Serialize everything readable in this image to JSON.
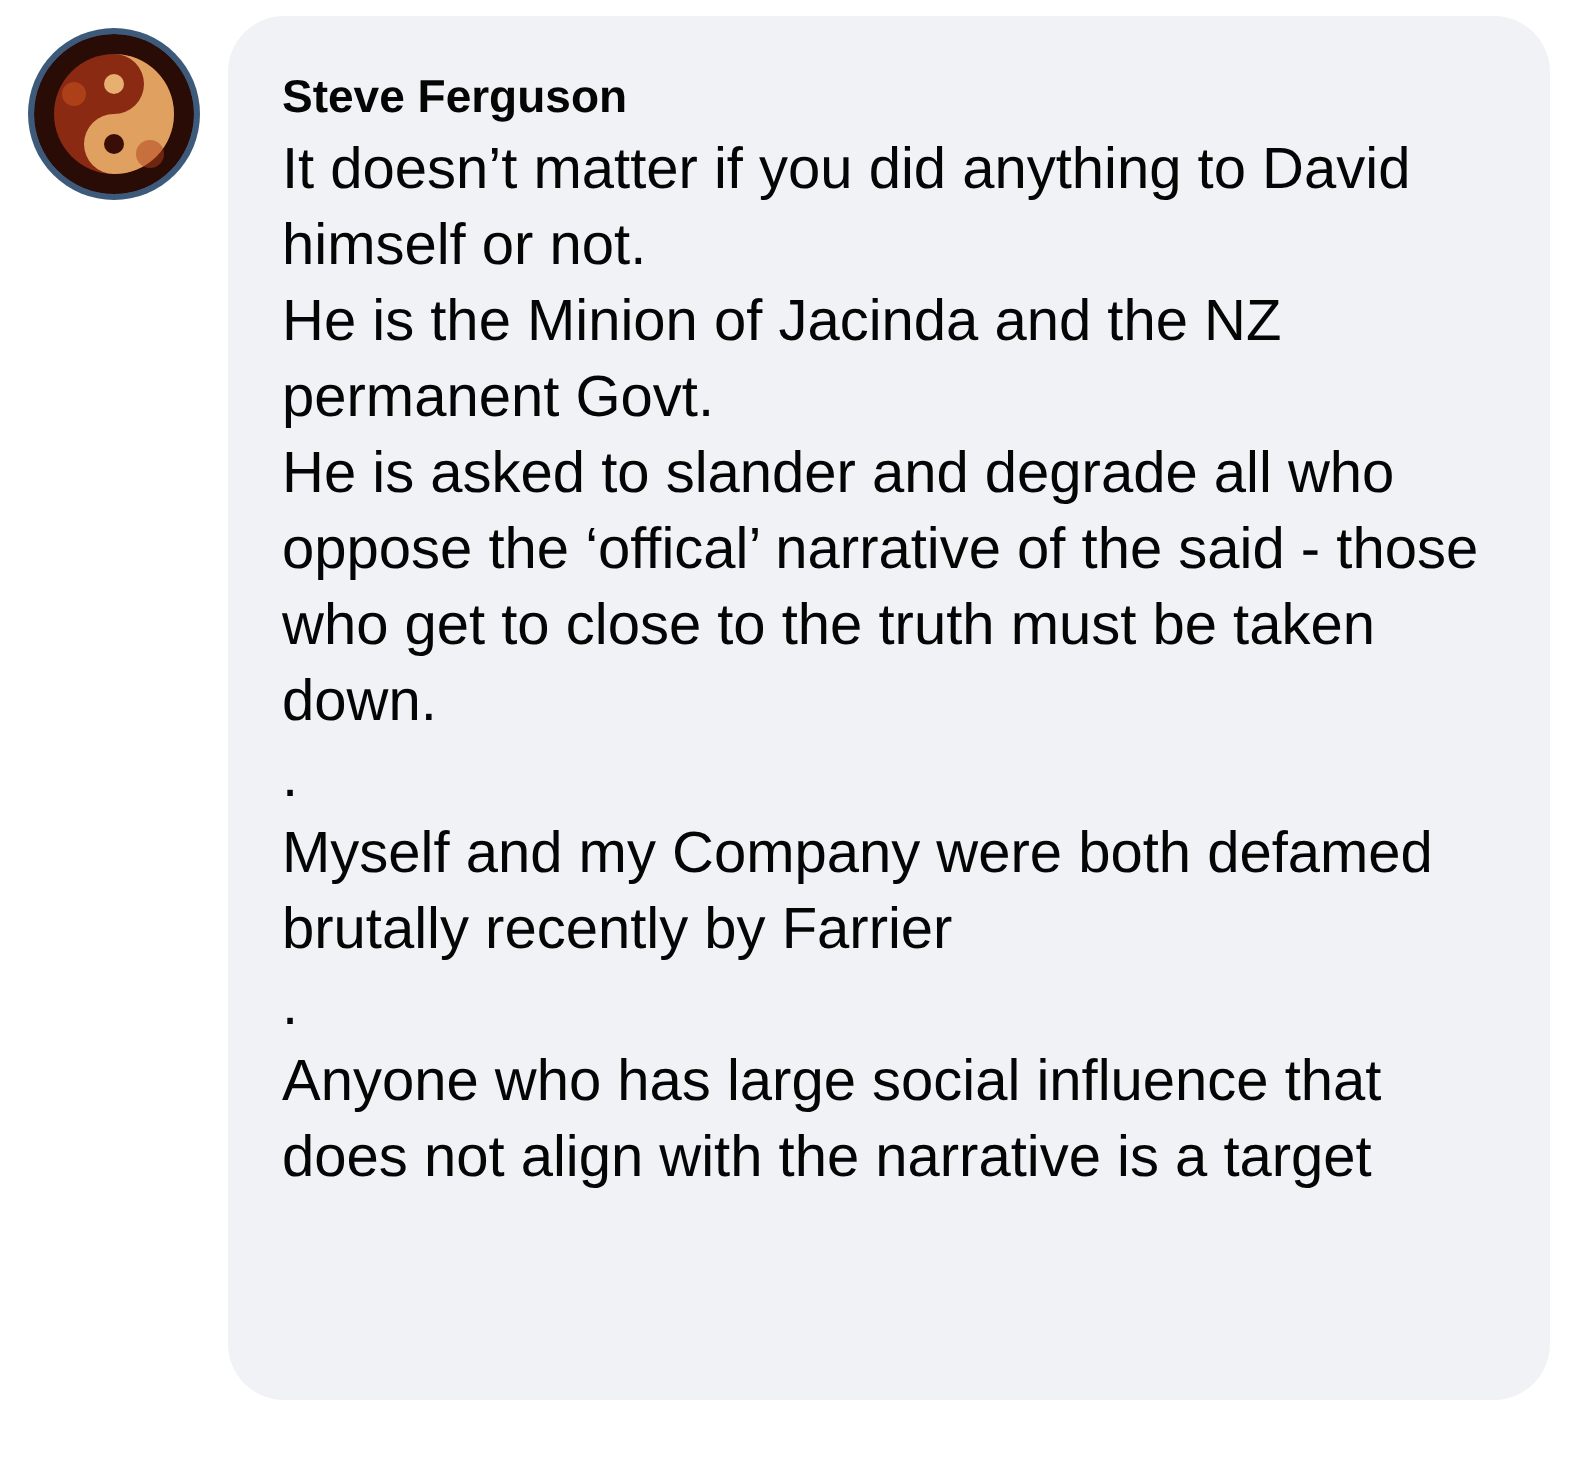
{
  "comment": {
    "author": "Steve Ferguson",
    "paragraphs": [
      "It doesn’t matter if you did anything to David himself or not.",
      "He is the Minion of Jacinda and the NZ permanent Govt.",
      "He is asked to slander and degrade all who oppose the ‘offical’ narrative of the said - those who get to close to the truth must be taken down.",
      ".",
      "Myself and my Company were both defamed brutally recently by Farrier",
      ".",
      "Anyone who has large social influence that does not align with the narrative is a target"
    ]
  }
}
